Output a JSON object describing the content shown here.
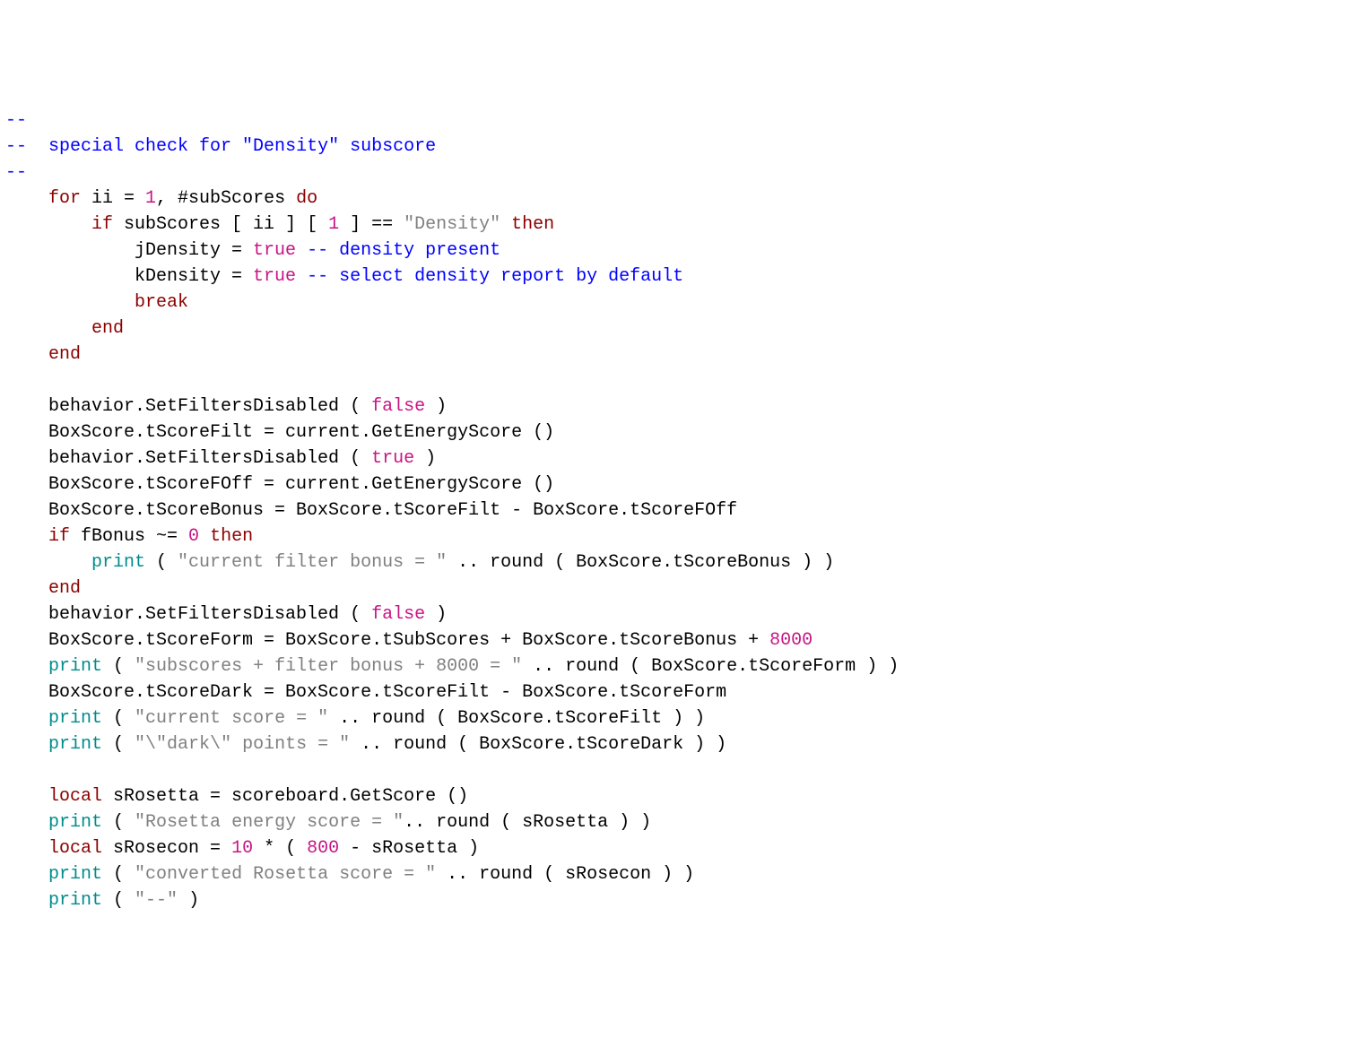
{
  "c1": "--",
  "c2a": "--",
  "c2b": "  special check for \"Density\" subscore",
  "c3": "--",
  "l4_for": "    for",
  "l4_rest": " ii = ",
  "l4_1": "1",
  "l4_after1": ", #subScores ",
  "l4_do": "do",
  "l5_if": "        if",
  "l5_mid": " subScores [ ii ] [ ",
  "l5_1": "1",
  "l5_eq": " ] == ",
  "l5_str": "\"Density\"",
  "l5_sp": " ",
  "l5_then": "then",
  "l6_a": "            jDensity = ",
  "l6_true": "true",
  "l6_sp": " ",
  "l6_cmt": "-- density present",
  "l7_a": "            kDensity = ",
  "l7_true": "true",
  "l7_sp": " ",
  "l7_cmt": "-- select density report by default",
  "l8_ind": "            ",
  "l8_break": "break",
  "l9_ind": "        ",
  "l9_end": "end",
  "l10_ind": "    ",
  "l10_end": "end",
  "blank": " ",
  "l12": "    behavior.SetFiltersDisabled ( ",
  "l12_false": "false",
  "l12_b": " )",
  "l13": "    BoxScore.tScoreFilt = current.GetEnergyScore ()",
  "l14": "    behavior.SetFiltersDisabled ( ",
  "l14_true": "true",
  "l14_b": " )",
  "l15": "    BoxScore.tScoreFOff = current.GetEnergyScore ()",
  "l16": "    BoxScore.tScoreBonus = BoxScore.tScoreFilt - BoxScore.tScoreFOff",
  "l17_if": "    if",
  "l17_mid": " fBonus ~= ",
  "l17_0": "0",
  "l17_sp": " ",
  "l17_then": "then",
  "l18_ind": "        ",
  "l18_print": "print",
  "l18_a": " ( ",
  "l18_str": "\"current filter bonus = \"",
  "l18_b": " .. round ( BoxScore.tScoreBonus ) )",
  "l19_ind": "    ",
  "l19_end": "end",
  "l20": "    behavior.SetFiltersDisabled ( ",
  "l20_false": "false",
  "l20_b": " )",
  "l21": "    BoxScore.tScoreForm = BoxScore.tSubScores + BoxScore.tScoreBonus + ",
  "l21_8000": "8000",
  "l22_ind": "    ",
  "l22_print": "print",
  "l22_a": " ( ",
  "l22_str": "\"subscores + filter bonus + 8000 = \"",
  "l22_b": " .. round ( BoxScore.tScoreForm ) )",
  "l23": "    BoxScore.tScoreDark = BoxScore.tScoreFilt - BoxScore.tScoreForm",
  "l24_ind": "    ",
  "l24_print": "print",
  "l24_a": " ( ",
  "l24_str": "\"current score = \"",
  "l24_b": " .. round ( BoxScore.tScoreFilt ) )",
  "l25_ind": "    ",
  "l25_print": "print",
  "l25_a": " ( ",
  "l25_str": "\"\\\"dark\\\" points = \"",
  "l25_b": " .. round ( BoxScore.tScoreDark ) )",
  "l27_ind": "    ",
  "l27_local": "local",
  "l27_b": " sRosetta = scoreboard.GetScore ()",
  "l28_ind": "    ",
  "l28_print": "print",
  "l28_a": " ( ",
  "l28_str": "\"Rosetta energy score = \"",
  "l28_b": ".. round ( sRosetta ) )",
  "l29_ind": "    ",
  "l29_local": "local",
  "l29_b": " sRosecon = ",
  "l29_10": "10",
  "l29_c": " * ( ",
  "l29_800": "800",
  "l29_d": " - sRosetta )",
  "l30_ind": "    ",
  "l30_print": "print",
  "l30_a": " ( ",
  "l30_str": "\"converted Rosetta score = \"",
  "l30_b": " .. round ( sRosecon ) )",
  "l31_ind": "    ",
  "l31_print": "print",
  "l31_a": " ( ",
  "l31_str": "\"--\"",
  "l31_b": " )"
}
